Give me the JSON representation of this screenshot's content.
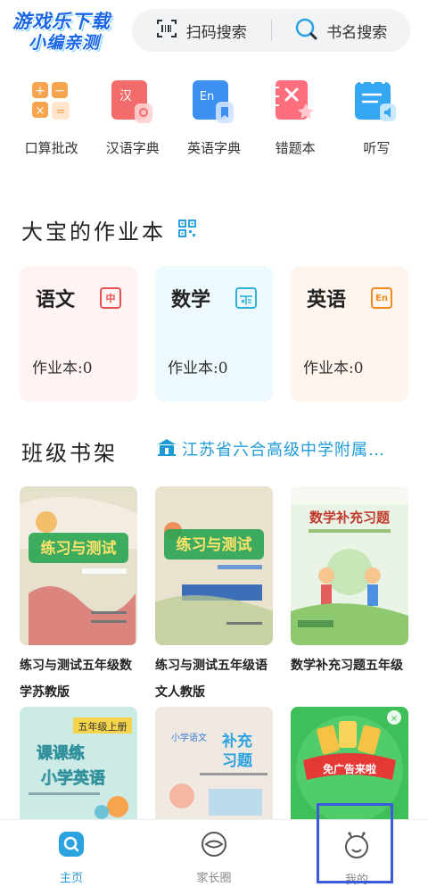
{
  "watermark": {
    "line1": "游戏乐下载",
    "line2": "小编亲测"
  },
  "search": {
    "scan_label": "扫码搜索",
    "book_label": "书名搜索"
  },
  "tools": [
    {
      "label": "口算批改",
      "icon": "calculator-icon",
      "color": "#f5a15a"
    },
    {
      "label": "汉语字典",
      "icon": "chinese-dictionary-icon",
      "color": "#f26c6c"
    },
    {
      "label": "英语字典",
      "icon": "english-dictionary-icon",
      "color": "#3d8ff0"
    },
    {
      "label": "错题本",
      "icon": "mistake-book-icon",
      "color": "#ff6e7d"
    },
    {
      "label": "听写",
      "icon": "dictation-icon",
      "color": "#35a6f2"
    }
  ],
  "homework": {
    "title": "大宝的作业本",
    "subjects": [
      {
        "name": "语文",
        "badge": "中",
        "count_label": "作业本:0",
        "badge_color": "#e85151",
        "bg": "#fff3f3"
      },
      {
        "name": "数学",
        "badge": "⊞",
        "count_label": "作业本:0",
        "badge_color": "#2cb3d6",
        "bg": "#eef9fd"
      },
      {
        "name": "英语",
        "badge": "En",
        "count_label": "作业本:0",
        "badge_color": "#f08a1c",
        "bg": "#fff5ef"
      }
    ]
  },
  "shelf": {
    "title": "班级书架",
    "school": "江苏省六合高级中学附属…",
    "books": [
      {
        "title": "练习与测试五年级数学苏教版",
        "cover_title": "练习与测试",
        "cover_bg": "#e7e3d0",
        "accent": "#1a9a4a"
      },
      {
        "title": "练习与测试五年级语文人教版",
        "cover_title": "练习与测试",
        "cover_bg": "#e8e2cf",
        "accent": "#1a9a4a"
      },
      {
        "title": "数学补充习题五年级",
        "cover_title": "数学补充习题",
        "cover_bg": "#e7f2e4",
        "accent": "#c0392b"
      }
    ],
    "books_row2": [
      {
        "cover_title": "课课练 小学英语",
        "cover_tag": "五年级上册",
        "cover_bg": "#cdebe6"
      },
      {
        "cover_title": "补充习题",
        "cover_tag": "小学语文",
        "cover_bg": "#f2eee8"
      },
      {
        "cover_title": "免广告来啦",
        "cover_tag": "",
        "cover_bg": "#38b34a"
      }
    ]
  },
  "nav": [
    {
      "label": "主页",
      "icon": "home-search-icon",
      "active": true
    },
    {
      "label": "家长圈",
      "icon": "parent-circle-icon",
      "active": false
    },
    {
      "label": "我的",
      "icon": "profile-icon",
      "active": false
    }
  ]
}
